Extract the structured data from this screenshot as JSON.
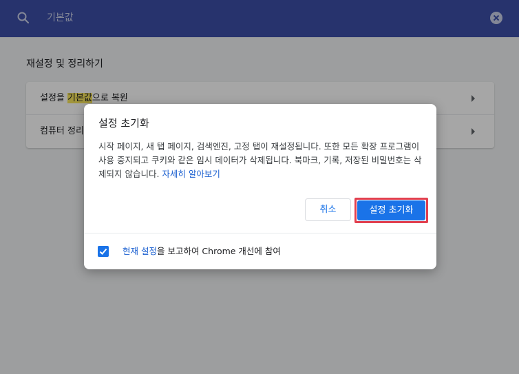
{
  "header": {
    "search_value": "기본값"
  },
  "page": {
    "section_title": "재설정 및 정리하기",
    "rows": [
      {
        "label_prefix": "설정을 ",
        "label_highlight": "기본값",
        "label_suffix": "으로 복원"
      },
      {
        "label": "컴퓨터 정리"
      }
    ]
  },
  "dialog": {
    "title": "설정 초기화",
    "body": "시작 페이지, 새 탭 페이지, 검색엔진, 고정 탭이 재설정됩니다. 또한 모든 확장 프로그램이 사용 중지되고 쿠키와 같은 임시 데이터가 삭제됩니다. 북마크, 기록, 저장된 비밀번호는 삭제되지 않습니다. ",
    "learn_more": "자세히 알아보기",
    "cancel_label": "취소",
    "reset_label": "설정 초기화",
    "report": {
      "checked": true,
      "link_text": "현재 설정",
      "suffix": "을 보고하여 Chrome 개선에 참여"
    }
  },
  "colors": {
    "header_bg": "#3c4fa8",
    "accent": "#1a73e8",
    "highlight_box": "#e2404f",
    "search_highlight": "#f7e55c"
  }
}
